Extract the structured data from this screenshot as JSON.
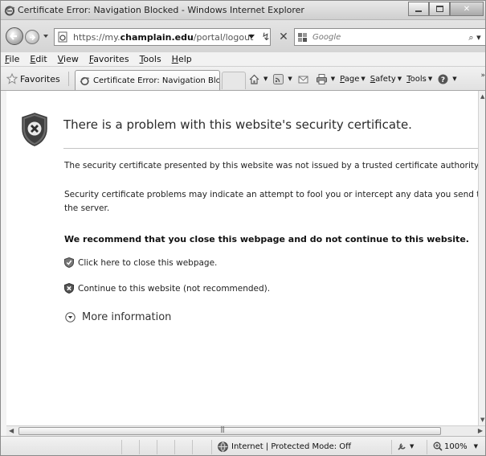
{
  "window": {
    "title": "Certificate Error: Navigation Blocked - Windows Internet Explorer"
  },
  "address": {
    "url_prefix": "https://my.",
    "url_domain": "champlain.edu",
    "url_path": "/portal/logout"
  },
  "search": {
    "placeholder": "Google"
  },
  "menu": {
    "items": [
      "File",
      "Edit",
      "View",
      "Favorites",
      "Tools",
      "Help"
    ]
  },
  "favorites_bar": {
    "favorites_label": "Favorites",
    "tab_title": "Certificate Error: Navigation Blocked"
  },
  "command_bar": {
    "page_label": "Page",
    "safety_label": "Safety",
    "tools_label": "Tools"
  },
  "content": {
    "heading": "There is a problem with this website's security certificate.",
    "para1": "The security certificate presented by this website was not issued by a trusted certificate authority.",
    "para2": "Security certificate problems may indicate an attempt to fool you or intercept any data you send to the server.",
    "recommend": "We recommend that you close this webpage and do not continue to this website.",
    "close_link": "Click here to close this webpage.",
    "continue_link": "Continue to this website (not recommended).",
    "more_info": "More information"
  },
  "status": {
    "zone_text": "Internet | Protected Mode: Off",
    "zoom_text": "100%"
  },
  "icons": {
    "shield": "shield-error-icon",
    "close_link": "shield-check-icon",
    "continue_link": "shield-x-icon",
    "more_info": "expand-circle-icon"
  }
}
